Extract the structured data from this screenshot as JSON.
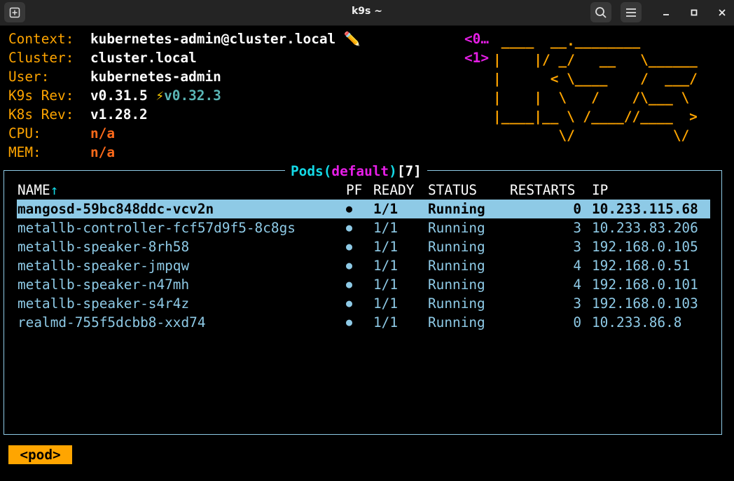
{
  "window": {
    "title": "k9s ~"
  },
  "info": {
    "context_label": "Context:",
    "context": "kubernetes-admin@cluster.local",
    "context_icon": "✏️",
    "cluster_label": "Cluster:",
    "cluster": "cluster.local",
    "user_label": "User:",
    "user": "kubernetes-admin",
    "k9s_label": "K9s Rev:",
    "k9s_rev": "v0.31.5",
    "k9s_upgrade_icon": "⚡",
    "k9s_new": "v0.32.3",
    "k8s_label": "K8s Rev:",
    "k8s_rev": "v1.28.2",
    "cpu_label": "CPU:",
    "cpu": "n/a",
    "mem_label": "MEM:",
    "mem": "n/a"
  },
  "hotkeys": [
    "<0…",
    "<1>"
  ],
  "logo": [
    " ____  __.________       ",
    "|    |/ _/   __   \\______",
    "|      < \\____    /  ___/",
    "|    |  \\   /    /\\___ \\ ",
    "|____|__ \\ /____//____  >",
    "        \\/            \\/ "
  ],
  "pods": {
    "title_resource": "Pods",
    "title_open": "(",
    "title_namespace": "default",
    "title_close": ")",
    "count": "[7]",
    "sort_icon": "↑",
    "columns": {
      "name": "NAME",
      "pf": "PF",
      "ready": "READY",
      "status": "STATUS",
      "restarts": "RESTARTS",
      "ip": "IP"
    },
    "rows": [
      {
        "name": "mangosd-59bc848ddc-vcv2n",
        "pf": "●",
        "ready": "1/1",
        "status": "Running",
        "restarts": "0",
        "ip": "10.233.115.68"
      },
      {
        "name": "metallb-controller-fcf57d9f5-8c8gs",
        "pf": "●",
        "ready": "1/1",
        "status": "Running",
        "restarts": "3",
        "ip": "10.233.83.206"
      },
      {
        "name": "metallb-speaker-8rh58",
        "pf": "●",
        "ready": "1/1",
        "status": "Running",
        "restarts": "3",
        "ip": "192.168.0.105"
      },
      {
        "name": "metallb-speaker-jmpqw",
        "pf": "●",
        "ready": "1/1",
        "status": "Running",
        "restarts": "4",
        "ip": "192.168.0.51"
      },
      {
        "name": "metallb-speaker-n47mh",
        "pf": "●",
        "ready": "1/1",
        "status": "Running",
        "restarts": "4",
        "ip": "192.168.0.101"
      },
      {
        "name": "metallb-speaker-s4r4z",
        "pf": "●",
        "ready": "1/1",
        "status": "Running",
        "restarts": "3",
        "ip": "192.168.0.103"
      },
      {
        "name": "realmd-755f5dcbb8-xxd74",
        "pf": "●",
        "ready": "1/1",
        "status": "Running",
        "restarts": "0",
        "ip": "10.233.86.8"
      }
    ]
  },
  "breadcrumb": "<pod>",
  "colors": {
    "accent": "#ffa500",
    "table": "#8ecae6",
    "title": "#14d9e6",
    "namespace": "#e61ee6",
    "highlight_value": "#ff6a1a"
  }
}
